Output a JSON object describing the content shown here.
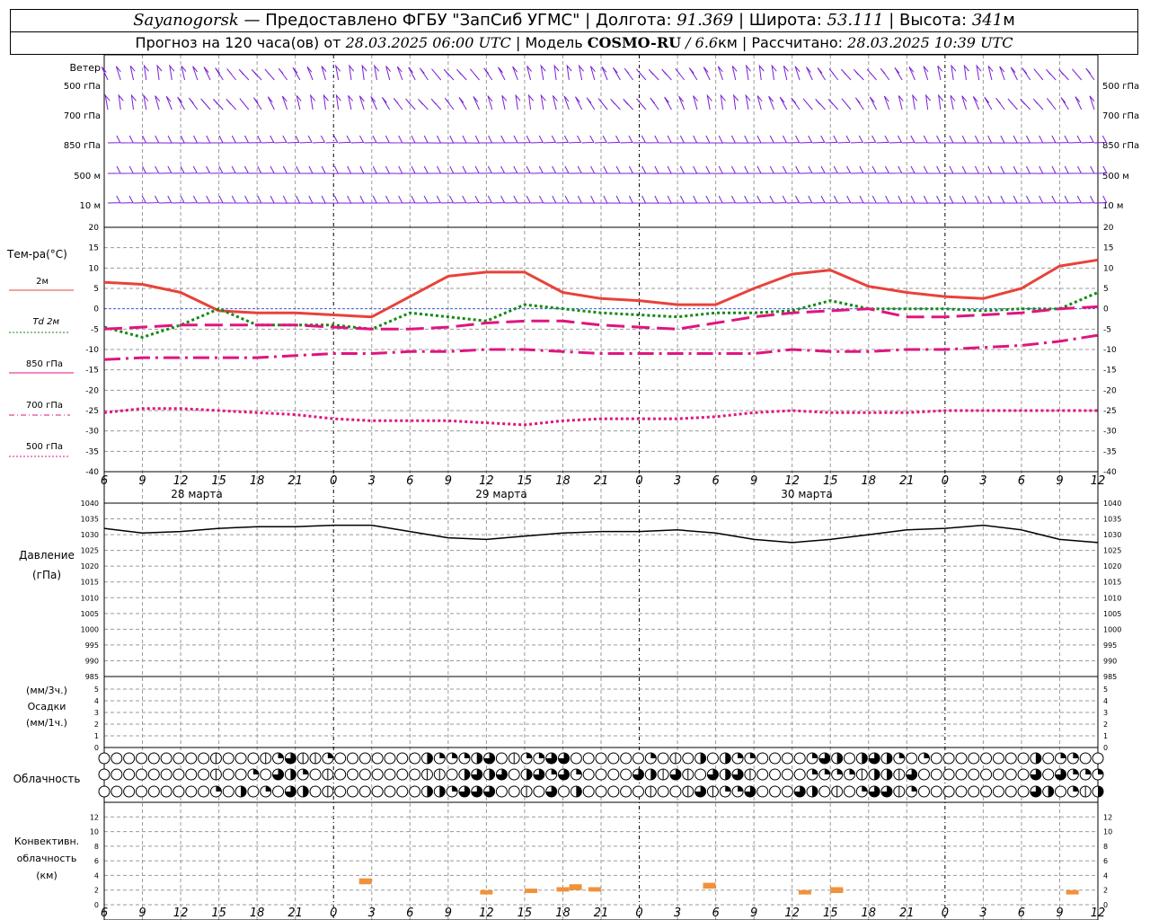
{
  "header": {
    "station": "Sayanogorsk",
    "dash": "—",
    "provider": "Предоставлено ФГБУ \"ЗапСиб УГМС\"",
    "lon_label": "Долгота:",
    "lon_value": "91.369",
    "lat_label": "Широта:",
    "lat_value": "53.111",
    "alt_label": "Высота:",
    "alt_value": "341",
    "alt_unit": "м",
    "sep": "|",
    "forecast_prefix": "Прогноз на 120 часа(ов) от",
    "forecast_time": "28.03.2025 06:00 UTC",
    "model_label": "Модель",
    "model_name": "COSMO-RU",
    "model_res": "/ 6.6",
    "model_res_unit": "км",
    "calc_label": "Рассчитано:",
    "calc_time": "28.03.2025 10:39 UTC"
  },
  "wind_panel": {
    "title": "Ветер",
    "levels": [
      "500 гПа",
      "700 гПа",
      "850 гПа",
      "500 м",
      "10  м"
    ],
    "right_levels": [
      "500 гПа",
      "700 гПа",
      "850 гПа",
      "500 м",
      "10  м"
    ],
    "barb_color": "#7a1fd6"
  },
  "legend": {
    "title": "Тем-ра(°С)",
    "items": [
      {
        "label": "2м",
        "color": "#e8423a",
        "style": "solid"
      },
      {
        "label": "Td  2м",
        "color": "#138a13",
        "style": "dotted"
      },
      {
        "label": "850 гПа",
        "color": "#e0157f",
        "style": "solid"
      },
      {
        "label": "700 гПа",
        "color": "#e0157f",
        "style": "dashdot"
      },
      {
        "label": "500 гПа",
        "color": "#e0157f",
        "style": "dotted"
      }
    ]
  },
  "time_axis": {
    "hour_labels": [
      "6",
      "9",
      "12",
      "15",
      "18",
      "21",
      "0",
      "3",
      "6",
      "9",
      "12",
      "15",
      "18",
      "21",
      "0",
      "3",
      "6",
      "9",
      "12",
      "15",
      "18",
      "21",
      "0",
      "3",
      "6",
      "9",
      "12"
    ],
    "dates": [
      "28 марта",
      "29 марта",
      "30 марта"
    ]
  },
  "pressure_panel": {
    "label1": "Давление",
    "label2": "(гПа)",
    "ticks": [
      "1040",
      "1035",
      "1030",
      "1025",
      "1020",
      "1015",
      "1010",
      "1005",
      "1000",
      "995",
      "990",
      "985"
    ]
  },
  "precip_panel": {
    "label1": "(мм/3ч.)",
    "label2": "Осадки",
    "label3": "(мм/1ч.)",
    "ticks": [
      "5",
      "4",
      "3",
      "2",
      "1",
      "0"
    ]
  },
  "cloud_panel": {
    "label": "Облачность"
  },
  "conv_panel": {
    "label1": "Конвективн.",
    "label2": "облачность",
    "label3": "(км)",
    "ticks": [
      "12",
      "10",
      "8",
      "6",
      "4",
      "2",
      "0"
    ]
  },
  "chart_data": [
    {
      "type": "line",
      "title": "Тем-ра(°С)",
      "x": [
        0,
        3,
        6,
        9,
        12,
        15,
        18,
        21,
        24,
        27,
        30,
        33,
        36,
        39,
        42,
        45,
        48,
        51,
        54,
        57,
        60,
        63,
        66,
        69,
        72,
        75,
        78
      ],
      "xlabel": "",
      "ylabel": "Тем-ра(°С)",
      "ylim": [
        -40,
        20
      ],
      "yticks": [
        20,
        15,
        10,
        5,
        0,
        -5,
        -10,
        -15,
        -20,
        -25,
        -30,
        -35,
        -40
      ],
      "grid": true,
      "series": [
        {
          "name": "2м",
          "values": [
            6.5,
            6,
            4,
            -0.5,
            -1,
            -1,
            -1.5,
            -2,
            3,
            8,
            9,
            9,
            4,
            2.5,
            2,
            1,
            1,
            5,
            8.5,
            9.5,
            5.5,
            4,
            3,
            2.5,
            5,
            10.5,
            12
          ]
        },
        {
          "name": "Td  2м",
          "values": [
            -4.5,
            -7,
            -4,
            0,
            -4,
            -4,
            -4,
            -5,
            -1,
            -2,
            -3,
            1,
            0,
            -1,
            -1.5,
            -2,
            -1,
            -1,
            -0.5,
            2,
            0,
            0,
            0,
            -0.5,
            0,
            0,
            4
          ]
        },
        {
          "name": "850 гПа",
          "values": [
            -5,
            -4.5,
            -4,
            -4,
            -4,
            -4,
            -4.5,
            -5,
            -5,
            -4.5,
            -3.5,
            -3,
            -3,
            -4,
            -4.5,
            -5,
            -3.5,
            -2,
            -1,
            -0.5,
            0,
            -2,
            -2,
            -1.5,
            -1,
            0,
            0.5
          ]
        },
        {
          "name": "700 гПа",
          "values": [
            -12.5,
            -12,
            -12,
            -12,
            -12,
            -11.5,
            -11,
            -11,
            -10.5,
            -10.5,
            -10,
            -10,
            -10.5,
            -11,
            -11,
            -11,
            -11,
            -11,
            -10,
            -10.5,
            -10.5,
            -10,
            -10,
            -9.5,
            -9,
            -8,
            -6.5
          ]
        },
        {
          "name": "500 гПа",
          "values": [
            -25.5,
            -24.5,
            -24.5,
            -25,
            -25.5,
            -26,
            -27,
            -27.5,
            -27.5,
            -27.5,
            -28,
            -28.5,
            -27.5,
            -27,
            -27,
            -27,
            -26.5,
            -25.5,
            -25,
            -25.5,
            -25.5,
            -25.5,
            -25,
            -25,
            -25,
            -25,
            -25
          ]
        }
      ]
    },
    {
      "type": "line",
      "title": "Давление",
      "x": [
        0,
        3,
        6,
        9,
        12,
        15,
        18,
        21,
        24,
        27,
        30,
        33,
        36,
        39,
        42,
        45,
        48,
        51,
        54,
        57,
        60,
        63,
        66,
        69,
        72,
        75,
        78
      ],
      "ylabel": "Давление (гПа)",
      "ylim": [
        985,
        1040
      ],
      "grid": true,
      "series": [
        {
          "name": "Давление",
          "values": [
            1032,
            1030.5,
            1031,
            1032,
            1032.5,
            1032.5,
            1033,
            1033,
            1031,
            1029,
            1028.5,
            1029.5,
            1030.5,
            1031,
            1031,
            1031.5,
            1030.5,
            1028.5,
            1027.5,
            1028.5,
            1030,
            1031.5,
            1032,
            1033,
            1031.5,
            1028.5,
            1027.5
          ]
        }
      ]
    },
    {
      "type": "bar",
      "title": "Осадки",
      "ylim": [
        0,
        5
      ],
      "series": [
        {
          "name": "Осадки",
          "values": []
        }
      ]
    },
    {
      "type": "bar",
      "title": "Конвективн. облачность",
      "ylabel": "(км)",
      "ylim": [
        0,
        14
      ],
      "bars": [
        {
          "x": 20.5,
          "base": 2.8,
          "top": 3.6
        },
        {
          "x": 30.0,
          "base": 1.4,
          "top": 2.0
        },
        {
          "x": 33.5,
          "base": 1.6,
          "top": 2.2
        },
        {
          "x": 36.0,
          "base": 1.8,
          "top": 2.4
        },
        {
          "x": 37.0,
          "base": 2.0,
          "top": 2.8
        },
        {
          "x": 38.5,
          "base": 1.8,
          "top": 2.4
        },
        {
          "x": 47.5,
          "base": 2.2,
          "top": 3.0
        },
        {
          "x": 55.0,
          "base": 1.4,
          "top": 2.0
        },
        {
          "x": 57.5,
          "base": 1.6,
          "top": 2.4
        },
        {
          "x": 76.0,
          "base": 1.4,
          "top": 2.0
        }
      ],
      "color": "#f0923a"
    }
  ]
}
